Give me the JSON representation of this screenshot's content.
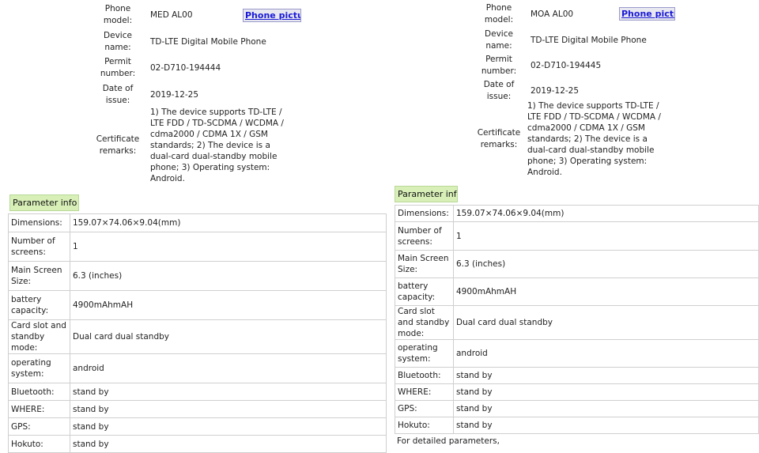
{
  "left": {
    "info": [
      {
        "label": "Phone model:",
        "value": "MED AL00"
      },
      {
        "label": "Device name:",
        "value": "TD-LTE Digital Mobile Phone"
      },
      {
        "label": "Permit number:",
        "value": "02-D710-194444"
      },
      {
        "label": "Date of issue:",
        "value": "2019-12-25"
      },
      {
        "label": "Certificate remarks:",
        "value": "1) The device supports TD-LTE / LTE FDD / TD-SCDMA / WCDMA / cdma2000 / CDMA 1X / GSM standards; 2) The device is a dual-card dual-standby mobile phone; 3) Operating system: Android."
      }
    ],
    "phone_picture_link": "Phone pictu",
    "param_header": "Parameter info",
    "params": [
      {
        "label": "Dimensions:",
        "value": "159.07×74.06×9.04(mm)"
      },
      {
        "label": "Number of screens:",
        "value": "1"
      },
      {
        "label": "Main Screen Size:",
        "value": "6.3 (inches)"
      },
      {
        "label": "battery capacity:",
        "value": "4900mAhmAH"
      },
      {
        "label": "Card slot and standby mode:",
        "value": "Dual card dual standby"
      },
      {
        "label": "operating system:",
        "value": "android"
      },
      {
        "label": "Bluetooth:",
        "value": "stand by"
      },
      {
        "label": "WHERE:",
        "value": "stand by"
      },
      {
        "label": "GPS:",
        "value": "stand by"
      },
      {
        "label": "Hokuto:",
        "value": "stand by"
      }
    ]
  },
  "right": {
    "info": [
      {
        "label": "Phone model:",
        "value": "MOA AL00"
      },
      {
        "label": "Device name:",
        "value": "TD-LTE Digital Mobile Phone"
      },
      {
        "label": "Permit number:",
        "value": "02-D710-194445"
      },
      {
        "label": "Date of issue:",
        "value": "2019-12-25"
      },
      {
        "label": "Certificate remarks:",
        "value": "1) The device supports TD-LTE / LTE FDD / TD-SCDMA / WCDMA / cdma2000 / CDMA 1X / GSM standards; 2) The device is a dual-card dual-standby mobile phone; 3) Operating system: Android."
      }
    ],
    "phone_picture_link": "Phone pictu",
    "param_header": "Parameter info",
    "params": [
      {
        "label": "Dimensions:",
        "value": "159.07×74.06×9.04(mm)"
      },
      {
        "label": "Number of screens:",
        "value": "1"
      },
      {
        "label": "Main Screen Size:",
        "value": "6.3 (inches)"
      },
      {
        "label": "battery capacity:",
        "value": "4900mAhmAH"
      },
      {
        "label": "Card slot and standby mode:",
        "value": "Dual card dual standby"
      },
      {
        "label": "operating system:",
        "value": "android"
      },
      {
        "label": "Bluetooth:",
        "value": "stand by"
      },
      {
        "label": "WHERE:",
        "value": "stand by"
      },
      {
        "label": "GPS:",
        "value": "stand by"
      },
      {
        "label": "Hokuto:",
        "value": "stand by"
      }
    ],
    "footer": "For detailed parameters,"
  }
}
